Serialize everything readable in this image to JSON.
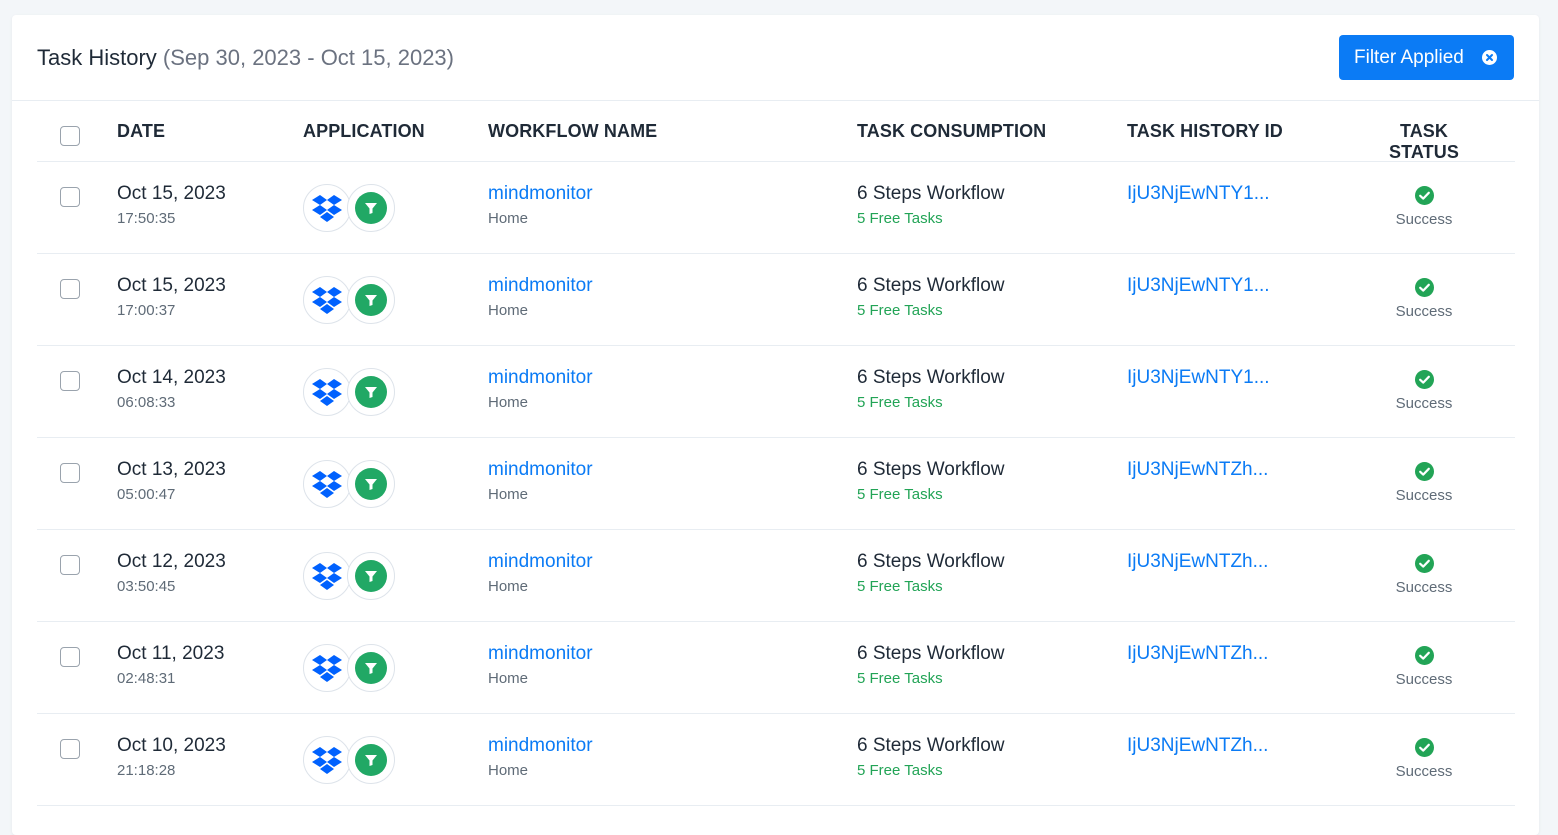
{
  "header": {
    "title": "Task History",
    "date_range": "(Sep 30, 2023 - Oct 15, 2023)",
    "filter_label": "Filter Applied"
  },
  "columns": {
    "date": "DATE",
    "application": "APPLICATION",
    "workflow_name": "WORKFLOW NAME",
    "task_consumption": "TASK CONSUMPTION",
    "task_history_id": "TASK HISTORY ID",
    "task_status": "TASK STATUS"
  },
  "icons": {
    "app_1": "dropbox-icon",
    "app_2": "filter-icon",
    "status": "check-circle-icon",
    "filter_clear": "close-circle-icon"
  },
  "colors": {
    "accent": "#0b7bf5",
    "success": "#22a456",
    "dropbox": "#0061fe"
  },
  "rows": [
    {
      "date": "Oct 15, 2023",
      "time": "17:50:35",
      "workflow": "mindmonitor",
      "folder": "Home",
      "consumption": "6 Steps Workflow",
      "tasks": "5 Free Tasks",
      "id": "IjU3NjEwNTY1...",
      "status": "Success"
    },
    {
      "date": "Oct 15, 2023",
      "time": "17:00:37",
      "workflow": "mindmonitor",
      "folder": "Home",
      "consumption": "6 Steps Workflow",
      "tasks": "5 Free Tasks",
      "id": "IjU3NjEwNTY1...",
      "status": "Success"
    },
    {
      "date": "Oct 14, 2023",
      "time": "06:08:33",
      "workflow": "mindmonitor",
      "folder": "Home",
      "consumption": "6 Steps Workflow",
      "tasks": "5 Free Tasks",
      "id": "IjU3NjEwNTY1...",
      "status": "Success"
    },
    {
      "date": "Oct 13, 2023",
      "time": "05:00:47",
      "workflow": "mindmonitor",
      "folder": "Home",
      "consumption": "6 Steps Workflow",
      "tasks": "5 Free Tasks",
      "id": "IjU3NjEwNTZh...",
      "status": "Success"
    },
    {
      "date": "Oct 12, 2023",
      "time": "03:50:45",
      "workflow": "mindmonitor",
      "folder": "Home",
      "consumption": "6 Steps Workflow",
      "tasks": "5 Free Tasks",
      "id": "IjU3NjEwNTZh...",
      "status": "Success"
    },
    {
      "date": "Oct 11, 2023",
      "time": "02:48:31",
      "workflow": "mindmonitor",
      "folder": "Home",
      "consumption": "6 Steps Workflow",
      "tasks": "5 Free Tasks",
      "id": "IjU3NjEwNTZh...",
      "status": "Success"
    },
    {
      "date": "Oct 10, 2023",
      "time": "21:18:28",
      "workflow": "mindmonitor",
      "folder": "Home",
      "consumption": "6 Steps Workflow",
      "tasks": "5 Free Tasks",
      "id": "IjU3NjEwNTZh...",
      "status": "Success"
    }
  ]
}
